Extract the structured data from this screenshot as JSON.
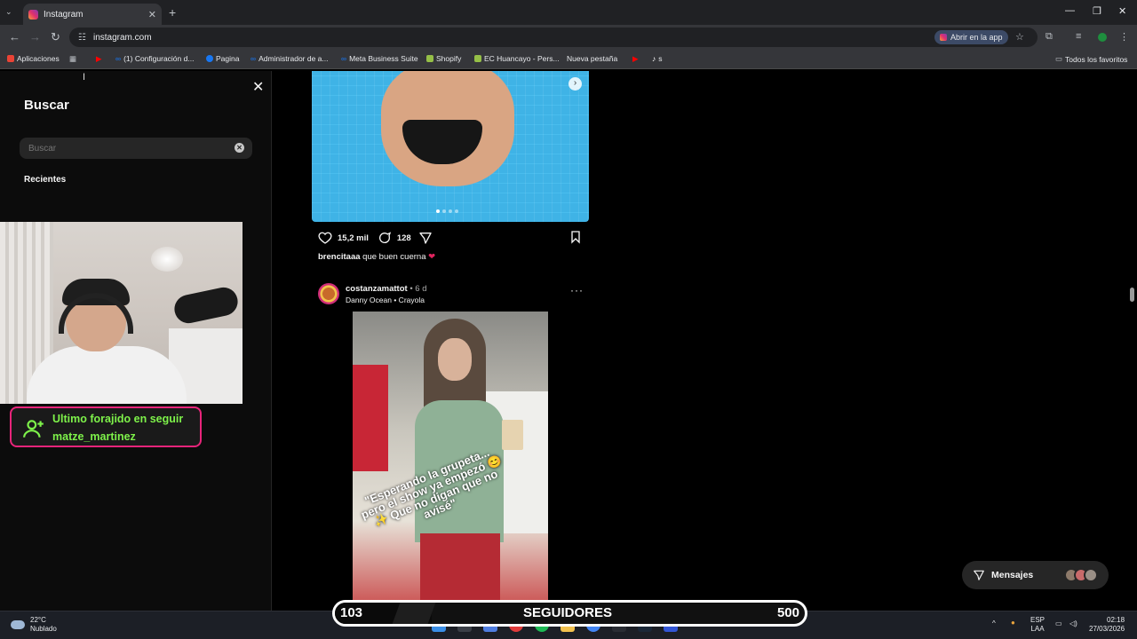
{
  "browser": {
    "tab_title": "Instagram",
    "url": "instagram.com",
    "open_in_app": "Abrir en la app",
    "bookmarks": [
      {
        "label": "Aplicaciones",
        "icon": "apps-grid-icon",
        "color": "#ea4335"
      },
      {
        "label": "(1) Configuración d...",
        "icon": "meta-icon",
        "color": "#1877f2"
      },
      {
        "label": "Pagina",
        "icon": "facebook-icon",
        "color": "#1877f2"
      },
      {
        "label": "Administrador de a...",
        "icon": "meta-icon",
        "color": "#1877f2"
      },
      {
        "label": "Meta Business Suite",
        "icon": "meta-icon",
        "color": "#1877f2"
      },
      {
        "label": "Shopify",
        "icon": "shopify-icon",
        "color": "#95bf47"
      },
      {
        "label": "EC Huancayo - Pers...",
        "icon": "shopify-icon",
        "color": "#95bf47"
      },
      {
        "label": "Nueva pestaña",
        "icon": "page-icon",
        "color": "#9aa0a6"
      },
      {
        "label": "s",
        "icon": "tiktok-icon",
        "color": "#ffffff"
      }
    ],
    "all_favorites": "Todos los favoritos"
  },
  "search_panel": {
    "title": "Buscar",
    "placeholder": "Buscar",
    "recents_label": "Recientes"
  },
  "follower_alert": {
    "line1": "Ultimo forajido en seguir",
    "line2": "matze_martinez"
  },
  "post1": {
    "likes": "15,2 mil",
    "comments": "128",
    "caption_user": "brencitaaa",
    "caption_text": "que buen cuerna",
    "caption_emoji": "❤"
  },
  "post2": {
    "username": "costanzamattot",
    "age": "• 6 d",
    "song": "Danny Ocean • Crayola",
    "overlay_text": "\"Esperando la grupeta... pero el show ya empezó 😊✨ Que no digan que no avisé\""
  },
  "messages": {
    "label": "Mensajes"
  },
  "follower_goal": {
    "current": "103",
    "label": "SEGUIDORES",
    "goal": "500",
    "progress": 0.206
  },
  "taskbar": {
    "temperature": "22°C",
    "weather": "Nublado",
    "lang1": "ESP",
    "lang2": "LAA",
    "time": "02:18",
    "date": "27/03/2026"
  },
  "colors": {
    "follower_text": "#7ef24a",
    "follower_border": "#e8247a",
    "pool": "#3fb3e6"
  }
}
